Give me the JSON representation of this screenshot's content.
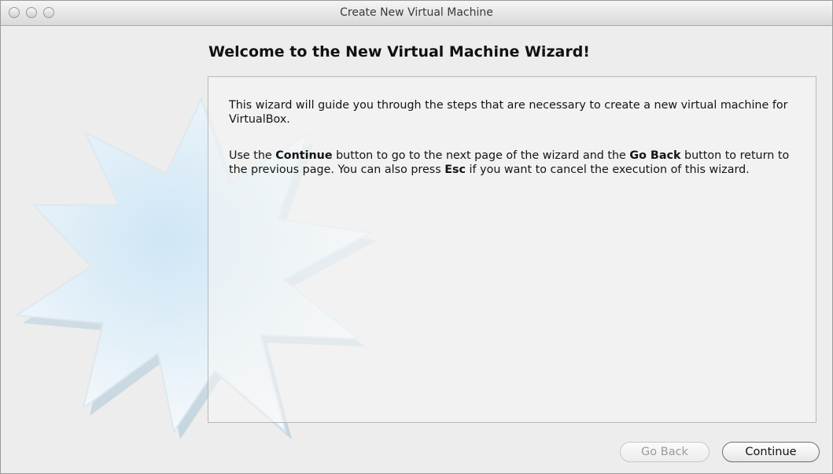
{
  "window": {
    "title": "Create New Virtual Machine"
  },
  "wizard": {
    "heading": "Welcome to the New Virtual Machine Wizard!",
    "paragraph1": "This wizard will guide you through the steps that are necessary to create a new virtual machine for VirtualBox.",
    "paragraph2": {
      "t1": "Use the ",
      "b1": "Continue",
      "t2": " button to go to the next page of the wizard and the ",
      "b2": "Go Back",
      "t3": " button to return to the previous page. You can also press ",
      "b3": "Esc",
      "t4": " if you want to cancel the execution of this wizard."
    }
  },
  "buttons": {
    "go_back": {
      "label": "Go Back",
      "enabled": false
    },
    "continue": {
      "label": "Continue",
      "enabled": true
    }
  },
  "icons": {
    "traffic_lights": [
      "close-icon",
      "minimize-icon",
      "zoom-icon"
    ],
    "watermark": "star-burst-icon"
  }
}
